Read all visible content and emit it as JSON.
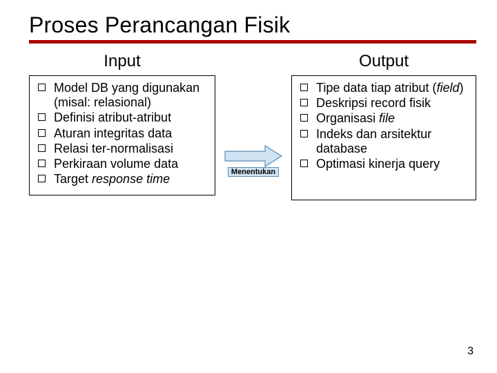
{
  "title": "Proses Perancangan Fisik",
  "input": {
    "heading": "Input",
    "items_html": [
      "Model DB yang digunakan (misal: relasional)",
      "Definisi atribut-atribut",
      "Aturan integritas data",
      "Relasi ter-normalisasi",
      "Perkiraan volume data",
      "Target <i>response time</i>"
    ]
  },
  "connector": {
    "label": "Menentukan"
  },
  "output": {
    "heading": "Output",
    "items_html": [
      "Tipe data tiap atribut (<i>field</i>)",
      "Deskripsi record fisik",
      "Organisasi <i>file</i>",
      "Indeks dan arsitektur database",
      "Optimasi kinerja query"
    ]
  },
  "page_number": "3",
  "colors": {
    "rule": "#a00",
    "arrow_fill": "#cfe3f3",
    "arrow_stroke": "#5b8cb5"
  }
}
